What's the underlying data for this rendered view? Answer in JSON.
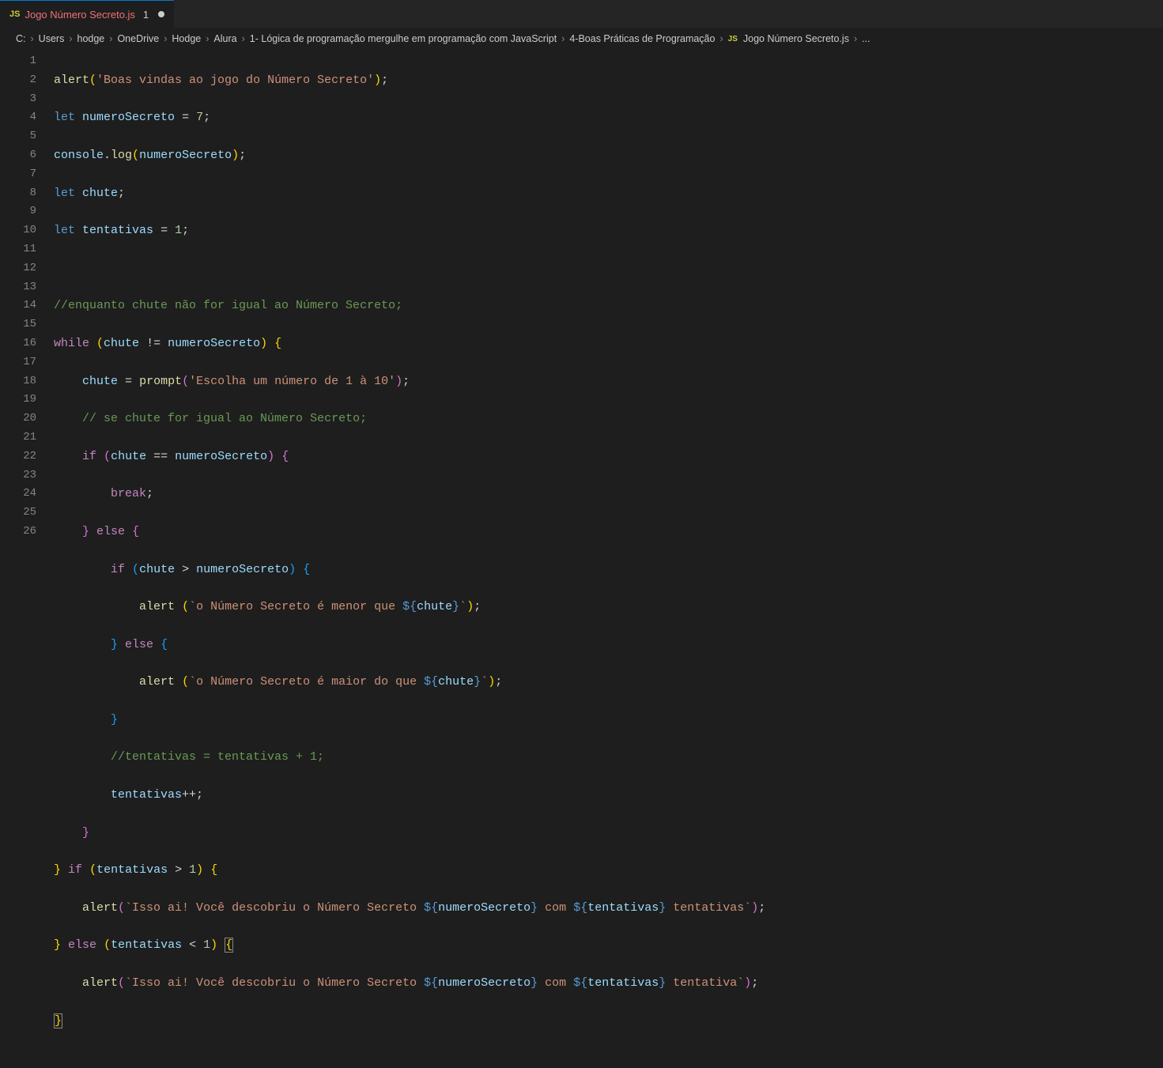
{
  "tab": {
    "icon": "JS",
    "filename": "Jogo Número Secreto.js",
    "problemCount": "1"
  },
  "breadcrumb": {
    "parts": [
      "C:",
      "Users",
      "hodge",
      "OneDrive",
      "Hodge",
      "Alura",
      "1- Lógica de programação mergulhe em programação com JavaScript",
      "4-Boas Práticas de Programação"
    ],
    "fileIcon": "JS",
    "file": "Jogo Número Secreto.js",
    "tail": "..."
  },
  "lineNumbers": [
    "1",
    "2",
    "3",
    "4",
    "5",
    "6",
    "7",
    "8",
    "9",
    "10",
    "11",
    "12",
    "13",
    "14",
    "15",
    "16",
    "17",
    "18",
    "19",
    "20",
    "21",
    "22",
    "23",
    "24",
    "25",
    "26"
  ],
  "code": {
    "l1": {
      "fn": "alert",
      "str": "'Boas vindas ao jogo do Número Secreto'"
    },
    "l2": {
      "kw": "let",
      "var": "numeroSecreto",
      "num": "7"
    },
    "l3": {
      "obj": "console",
      "fn": "log",
      "var": "numeroSecreto"
    },
    "l4": {
      "kw": "let",
      "var": "chute"
    },
    "l5": {
      "kw": "let",
      "var": "tentativas",
      "num": "1"
    },
    "l7": {
      "cmt": "//enquanto chute não for igual ao Número Secreto;"
    },
    "l8": {
      "kw": "while",
      "v1": "chute",
      "op": "!=",
      "v2": "numeroSecreto"
    },
    "l9": {
      "var": "chute",
      "fn": "prompt",
      "str": "'Escolha um número de 1 à 10'"
    },
    "l10": {
      "cmt": "// se chute for igual ao Número Secreto;"
    },
    "l11": {
      "kw": "if",
      "v1": "chute",
      "op": "==",
      "v2": "numeroSecreto"
    },
    "l12": {
      "kw": "break"
    },
    "l13": {
      "kw": "else"
    },
    "l14": {
      "kw": "if",
      "v1": "chute",
      "op": ">",
      "v2": "numeroSecreto"
    },
    "l15": {
      "fn": "alert",
      "s1": "`o Número Secreto é menor que ",
      "tv": "chute",
      "s2": "`"
    },
    "l16": {
      "kw": "else"
    },
    "l17": {
      "fn": "alert",
      "s1": "`o Número Secreto é maior do que ",
      "tv": "chute",
      "s2": "`"
    },
    "l19": {
      "cmt": "//tentativas = tentativas + 1;"
    },
    "l20": {
      "var": "tentativas"
    },
    "l22": {
      "kw": "if",
      "v1": "tentativas",
      "op": ">",
      "num": "1"
    },
    "l23": {
      "fn": "alert",
      "s1": "`Isso ai! Você descobriu o Número Secreto ",
      "tv1": "numeroSecreto",
      "s2": " com ",
      "tv2": "tentativas",
      "s3": " tentativas`"
    },
    "l24": {
      "kw": "else",
      "v1": "tentativas",
      "op": "<",
      "num": "1"
    },
    "l25": {
      "fn": "alert",
      "s1": "`Isso ai! Você descobriu o Número Secreto ",
      "tv1": "numeroSecreto",
      "s2": " com ",
      "tv2": "tentativas",
      "s3": " tentativa`"
    }
  }
}
